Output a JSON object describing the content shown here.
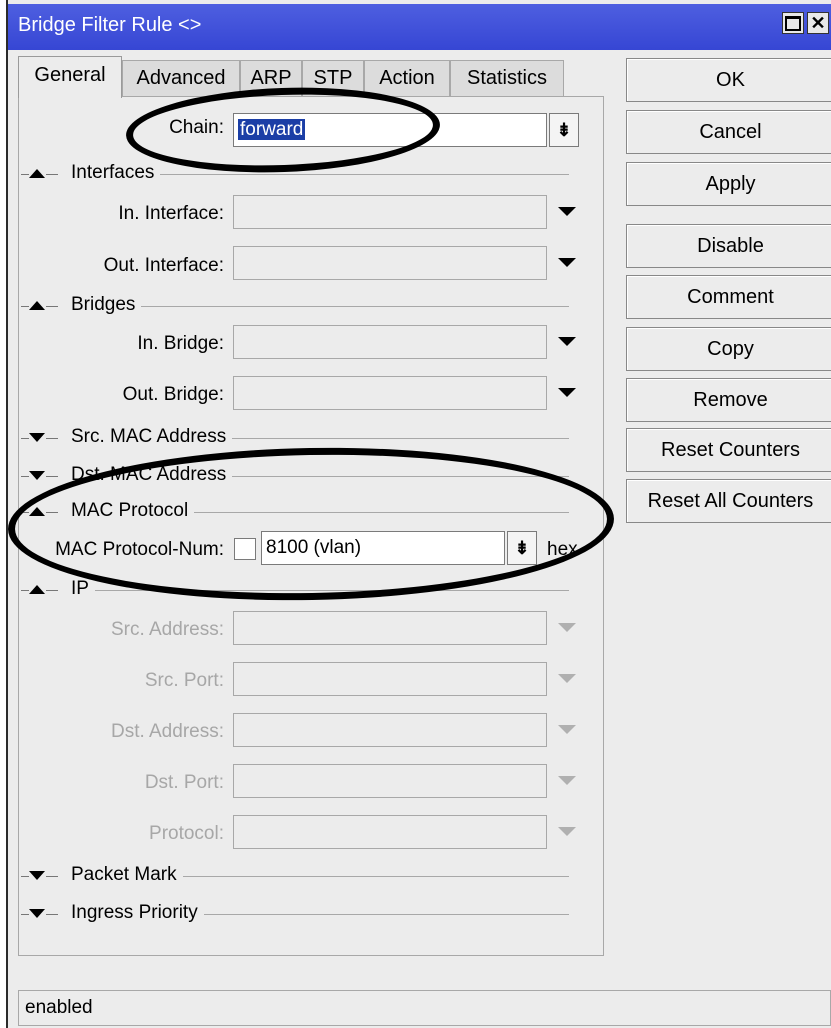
{
  "window": {
    "title": "Bridge Filter Rule <>"
  },
  "tabs": [
    "General",
    "Advanced",
    "ARP",
    "STP",
    "Action",
    "Statistics"
  ],
  "general": {
    "chain": {
      "label": "Chain:",
      "value": "forward"
    },
    "sections": {
      "interfaces": "Interfaces",
      "bridges": "Bridges",
      "src_mac": "Src. MAC Address",
      "dst_mac": "Dst. MAC Address",
      "mac_protocol": "MAC Protocol",
      "ip": "IP",
      "packet_mark": "Packet Mark",
      "ingress_priority": "Ingress Priority"
    },
    "fields": {
      "in_interface": "In. Interface:",
      "out_interface": "Out. Interface:",
      "in_bridge": "In. Bridge:",
      "out_bridge": "Out. Bridge:",
      "mac_protocol_num": "MAC Protocol-Num:",
      "mac_protocol_value": "8100 (vlan)",
      "hex": "hex",
      "src_address": "Src. Address:",
      "src_port": "Src. Port:",
      "dst_address": "Dst. Address:",
      "dst_port": "Dst. Port:",
      "protocol": "Protocol:"
    }
  },
  "buttons": [
    "OK",
    "Cancel",
    "Apply",
    "Disable",
    "Comment",
    "Copy",
    "Remove",
    "Reset Counters",
    "Reset All Counters"
  ],
  "status": "enabled"
}
